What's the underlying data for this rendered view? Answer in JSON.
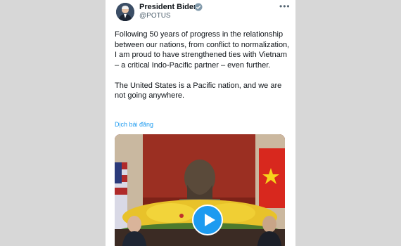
{
  "tweet": {
    "display_name": "President Biden",
    "handle": "@POTUS",
    "verified_icon": "verified-badge-icon",
    "more_icon": "more-options-icon",
    "paragraphs": [
      "Following 50 years of progress in the relationship between our nations, from conflict to normalization, I am proud to have strengthened ties with Vietnam – a critical Indo-Pacific partner – even further.",
      "The United States is a Pacific nation, and we are not going anywhere."
    ],
    "translate_label": "Dịch bài đăng",
    "media": {
      "play_icon": "play-icon"
    }
  }
}
